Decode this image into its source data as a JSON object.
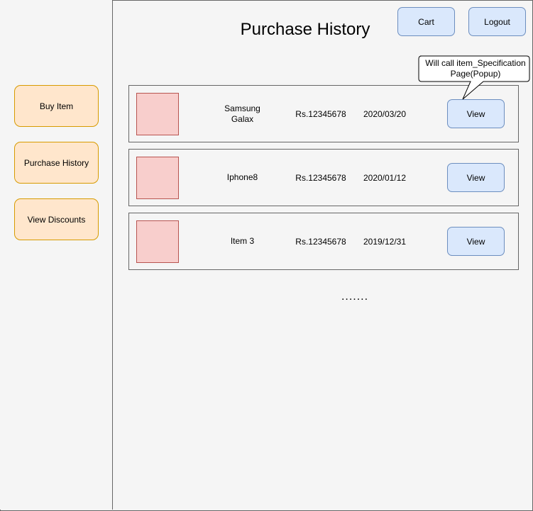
{
  "page": {
    "title": "Purchase History",
    "more_indicator": "......."
  },
  "header": {
    "cart_label": "Cart",
    "logout_label": "Logout"
  },
  "sidebar": {
    "items": [
      {
        "label": "Buy Item"
      },
      {
        "label": "Purchase History"
      },
      {
        "label": "View Discounts"
      }
    ]
  },
  "purchases": [
    {
      "name": "Samsung Galax",
      "price": "Rs.12345678",
      "date": "2020/03/20",
      "action": "View"
    },
    {
      "name": "Iphone8",
      "price": "Rs.12345678",
      "date": "2020/01/12",
      "action": "View"
    },
    {
      "name": "Item 3",
      "price": "Rs.12345678",
      "date": "2019/12/31",
      "action": "View"
    }
  ],
  "annotation": {
    "text": "Will call item_Specification Page(Popup)"
  },
  "colors": {
    "canvas": "#f5f5f5",
    "border": "#666666",
    "nav_fill": "#ffe6cc",
    "nav_stroke": "#d79b00",
    "button_fill": "#dae8fc",
    "button_stroke": "#6c8ebf",
    "thumb_fill": "#f8cecc",
    "thumb_stroke": "#b85450"
  }
}
